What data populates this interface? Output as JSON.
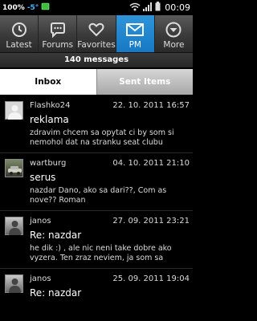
{
  "status_bar": {
    "battery_percent": "100%",
    "temperature": "-5°",
    "time": "00:09"
  },
  "tabs": [
    {
      "label": "Latest",
      "icon": "clock-icon",
      "active": false
    },
    {
      "label": "Forums",
      "icon": "chat-bubble-icon",
      "active": false
    },
    {
      "label": "Favorites",
      "icon": "heart-icon",
      "active": false
    },
    {
      "label": "PM",
      "icon": "envelope-icon",
      "active": true
    },
    {
      "label": "More",
      "icon": "chevron-down-icon",
      "active": false
    }
  ],
  "message_count": "140 messages",
  "segments": {
    "inbox": "Inbox",
    "sent": "Sent Items"
  },
  "messages": [
    {
      "sender": "Flashko24",
      "date": "22. 10. 2011 16:57",
      "subject": "reklama",
      "preview": "zdravim chcem sa opytat ci by som si nemohol dat na stranku seat clubu"
    },
    {
      "sender": "wartburg",
      "date": "04. 10. 2011 21:10",
      "subject": "serus",
      "preview": "nazdar Dano,  ako sa dari??, Com as nove?? Roman"
    },
    {
      "sender": "janos",
      "date": "27. 09. 2011 23:21",
      "subject": "Re: nazdar",
      "preview": "he dik :) , ale nic neni take dobre ako vyzera. Ten zraz neviem, ja som sa"
    },
    {
      "sender": "janos",
      "date": "25. 09. 2011 19:04",
      "subject": "Re: nazdar",
      "preview": ""
    }
  ]
}
